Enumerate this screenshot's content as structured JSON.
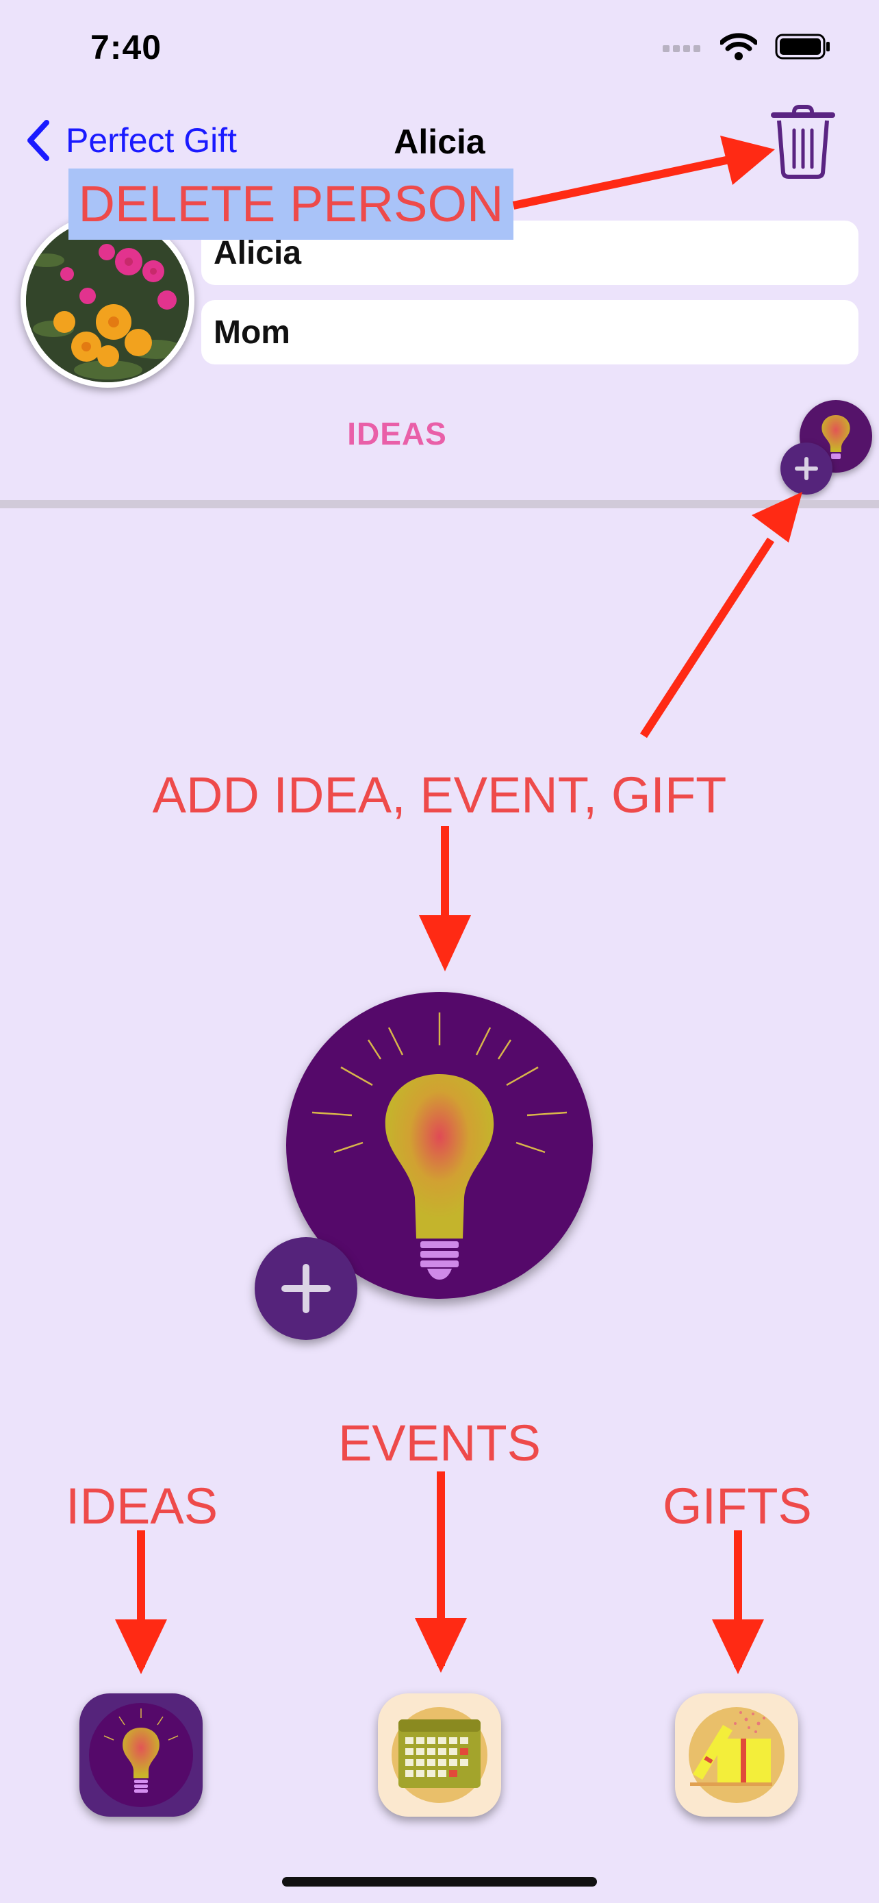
{
  "status_bar": {
    "time": "7:40"
  },
  "nav": {
    "back_label": "Perfect Gift",
    "title": "Alicia"
  },
  "profile": {
    "name_value": "Alicia",
    "relation_value": "Mom"
  },
  "section": {
    "title": "IDEAS"
  },
  "annotations": {
    "delete_person": "DELETE PERSON",
    "add_item": "ADD IDEA, EVENT, GIFT",
    "events": "EVENTS",
    "ideas": "IDEAS",
    "gifts": "GIFTS"
  },
  "icons": {
    "back": "chevron-left-icon",
    "trash": "trash-icon",
    "add": "plus-icon",
    "idea": "lightbulb-icon",
    "events": "calendar-icon",
    "gifts": "gift-box-icon"
  },
  "colors": {
    "background": "#ece3fb",
    "link": "#1a1aff",
    "annotation": "#ee4a4a",
    "arrow": "#ff2a14",
    "accent_purple": "#55136a",
    "section_title": "#e95fa8"
  }
}
